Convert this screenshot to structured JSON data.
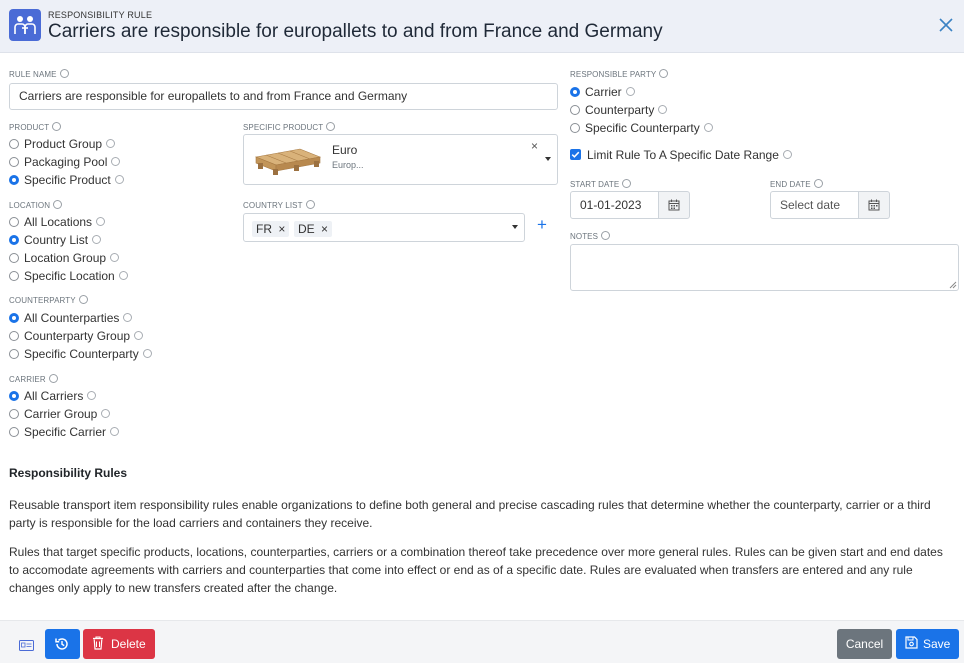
{
  "header": {
    "subtitle": "RESPONSIBILITY RULE",
    "title": "Carriers are responsible for europallets to and from France and Germany"
  },
  "rule_name": {
    "label": "RULE NAME",
    "value": "Carriers are responsible for europallets to and from France and Germany"
  },
  "product": {
    "label": "PRODUCT",
    "options": [
      "Product Group",
      "Packaging Pool",
      "Specific Product"
    ],
    "selected": "Specific Product"
  },
  "specific_product": {
    "label": "SPECIFIC PRODUCT",
    "name": "Euro",
    "description": "Europ...",
    "clear": "×"
  },
  "location": {
    "label": "LOCATION",
    "options": [
      "All Locations",
      "Country List",
      "Location Group",
      "Specific Location"
    ],
    "selected": "Country List"
  },
  "country_list": {
    "label": "COUNTRY LIST",
    "tags": [
      "FR",
      "DE"
    ],
    "remove": "×",
    "add": "+"
  },
  "counterparty": {
    "label": "COUNTERPARTY",
    "options": [
      "All Counterparties",
      "Counterparty Group",
      "Specific Counterparty"
    ],
    "selected": "All Counterparties"
  },
  "carrier": {
    "label": "CARRIER",
    "options": [
      "All Carriers",
      "Carrier Group",
      "Specific Carrier"
    ],
    "selected": "All Carriers"
  },
  "responsible_party": {
    "label": "RESPONSIBLE PARTY",
    "options": [
      "Carrier",
      "Counterparty",
      "Specific Counterparty"
    ],
    "selected": "Carrier"
  },
  "date_limit": {
    "label": "Limit Rule To A Specific Date Range",
    "checked": true
  },
  "start_date": {
    "label": "START DATE",
    "value": "01-01-2023"
  },
  "end_date": {
    "label": "END DATE",
    "placeholder": "Select date"
  },
  "notes": {
    "label": "NOTES",
    "value": ""
  },
  "info_section": {
    "title": "Responsibility Rules",
    "paragraph1": "Reusable transport item responsibility rules enable organizations to define both general and precise cascading rules that determine whether the counterparty, carrier or a third party is responsible for the load carriers and containers they receive.",
    "paragraph2": "Rules that target specific products, locations, counterparties, carriers or a combination thereof take precedence over more general rules. Rules can be given start and end dates to accomodate agreements with carriers and counterparties that come into effect or end as of a specific date. Rules are evaluated when transfers are entered and any rule changes only apply to new transfers created after the change."
  },
  "footer": {
    "delete_label": "Delete",
    "cancel_label": "Cancel",
    "save_label": "Save"
  },
  "colors": {
    "primary": "#1a73e8",
    "danger": "#dc3545",
    "secondary": "#6c757d",
    "header_bg": "#edf0f7"
  }
}
